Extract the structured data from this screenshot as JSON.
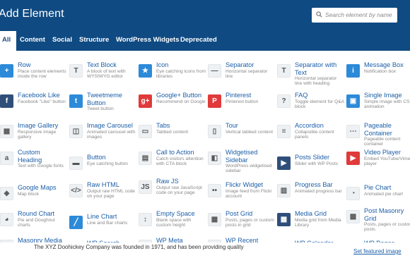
{
  "header": {
    "title": "Add Element",
    "search_placeholder": "Search element by name"
  },
  "tabs": [
    {
      "label": "All",
      "active": true
    },
    {
      "label": "Content"
    },
    {
      "label": "Social"
    },
    {
      "label": "Structure"
    },
    {
      "label": "WordPress Widgets"
    },
    {
      "label": "Deprecated"
    }
  ],
  "elements": [
    [
      {
        "name": "Row",
        "desc": "Place content elements inside the row",
        "icon": "plus-icon"
      },
      {
        "name": "Text Block",
        "desc": "A block of text with WYSIWYG editor",
        "icon": "text-block-icon"
      },
      {
        "name": "Icon",
        "desc": "Eye catching icons from libraries",
        "icon": "star-icon"
      },
      {
        "name": "Separator",
        "desc": "Horizontal separator line",
        "icon": "separator-icon"
      },
      {
        "name": "Separator with Text",
        "desc": "Horizontal separator line with heading",
        "icon": "separator-text-icon"
      },
      {
        "name": "Message Box",
        "desc": "Notification box",
        "icon": "info-icon"
      }
    ],
    [
      {
        "name": "Facebook Like",
        "desc": "Facebook \"Like\" button",
        "icon": "facebook-icon"
      },
      {
        "name": "Tweetmeme Button",
        "desc": "Tweet button",
        "icon": "twitter-icon"
      },
      {
        "name": "Google+ Button",
        "desc": "Recommend on Google",
        "icon": "google-plus-icon"
      },
      {
        "name": "Pinterest",
        "desc": "Pinterest button",
        "icon": "pinterest-icon"
      },
      {
        "name": "FAQ",
        "desc": "Toggle element for Q&A block",
        "icon": "faq-icon"
      },
      {
        "name": "Single Image",
        "desc": "Simple image with CSS animation",
        "icon": "image-icon"
      }
    ],
    [
      {
        "name": "Image Gallery",
        "desc": "Responsive image gallery",
        "icon": "gallery-icon"
      },
      {
        "name": "Image Carousel",
        "desc": "Animated carousel with images",
        "icon": "carousel-icon"
      },
      {
        "name": "Tabs",
        "desc": "Tabbed content",
        "icon": "tabs-icon"
      },
      {
        "name": "Tour",
        "desc": "Vertical tabbed content",
        "icon": "tour-icon"
      },
      {
        "name": "Accordion",
        "desc": "Collapsible content panels",
        "icon": "accordion-icon"
      },
      {
        "name": "Pageable Container",
        "desc": "Pageable content container",
        "icon": "pageable-icon"
      }
    ],
    [
      {
        "name": "Custom Heading",
        "desc": "Text with Google fonts",
        "icon": "heading-icon"
      },
      {
        "name": "Button",
        "desc": "Eye catching button",
        "icon": "button-icon"
      },
      {
        "name": "Call to Action",
        "desc": "Catch visitors attention with CTA block",
        "icon": "cta-icon"
      },
      {
        "name": "Widgetised Sidebar",
        "desc": "WordPress widgetised sidebar",
        "icon": "sidebar-icon"
      },
      {
        "name": "Posts Slider",
        "desc": "Slider with WP Posts",
        "icon": "slider-icon"
      },
      {
        "name": "Video Player",
        "desc": "Embed YouTube/Vimeo player",
        "icon": "video-icon"
      }
    ],
    [
      {
        "name": "Google Maps",
        "desc": "Map block",
        "icon": "map-icon"
      },
      {
        "name": "Raw HTML",
        "desc": "Output raw HTML code on your page",
        "icon": "html-icon"
      },
      {
        "name": "Raw JS",
        "desc": "Output raw JavaScript code on your page",
        "icon": "js-icon"
      },
      {
        "name": "Flickr Widget",
        "desc": "Image feed from Flickr account",
        "icon": "flickr-icon"
      },
      {
        "name": "Progress Bar",
        "desc": "Animated progress bar",
        "icon": "progress-icon"
      },
      {
        "name": "Pie Chart",
        "desc": "Animated pie chart",
        "icon": "pie-chart-icon"
      }
    ],
    [
      {
        "name": "Round Chart",
        "desc": "Pie and Doughnut charts",
        "icon": "round-chart-icon"
      },
      {
        "name": "Line Chart",
        "desc": "Line and Bar charts",
        "icon": "line-chart-icon"
      },
      {
        "name": "Empty Space",
        "desc": "Blank space with custom height",
        "icon": "empty-space-icon"
      },
      {
        "name": "Post Grid",
        "desc": "Posts, pages or custom posts in grid",
        "icon": "post-grid-icon"
      },
      {
        "name": "Media Grid",
        "desc": "Media grid from Media Library",
        "icon": "media-grid-icon"
      },
      {
        "name": "Post Masonry Grid",
        "desc": "Posts, pages or custom posts",
        "icon": "masonry-icon"
      }
    ],
    [
      {
        "name": "Masonry Media",
        "desc": "",
        "icon": "masonry-media-icon"
      },
      {
        "name": "WP Search",
        "desc": "",
        "icon": "wp-search-icon"
      },
      {
        "name": "WP Meta",
        "desc": "",
        "icon": "wp-meta-icon"
      },
      {
        "name": "WP Recent Comments",
        "desc": "",
        "icon": "wp-comments-icon"
      },
      {
        "name": "WP Calendar",
        "desc": "",
        "icon": "wp-calendar-icon"
      },
      {
        "name": "WP Pages",
        "desc": "",
        "icon": "wp-pages-icon"
      }
    ]
  ],
  "background_doc": {
    "text": "The XYZ Doohickey Company was founded in 1971, and has been providing quality",
    "featured_link": "Set featured image"
  },
  "colors": {
    "header": "#0f4a82",
    "link": "#1c5fa8",
    "accent_blue": "#2d8ad8",
    "accent_red": "#e03a3a"
  }
}
